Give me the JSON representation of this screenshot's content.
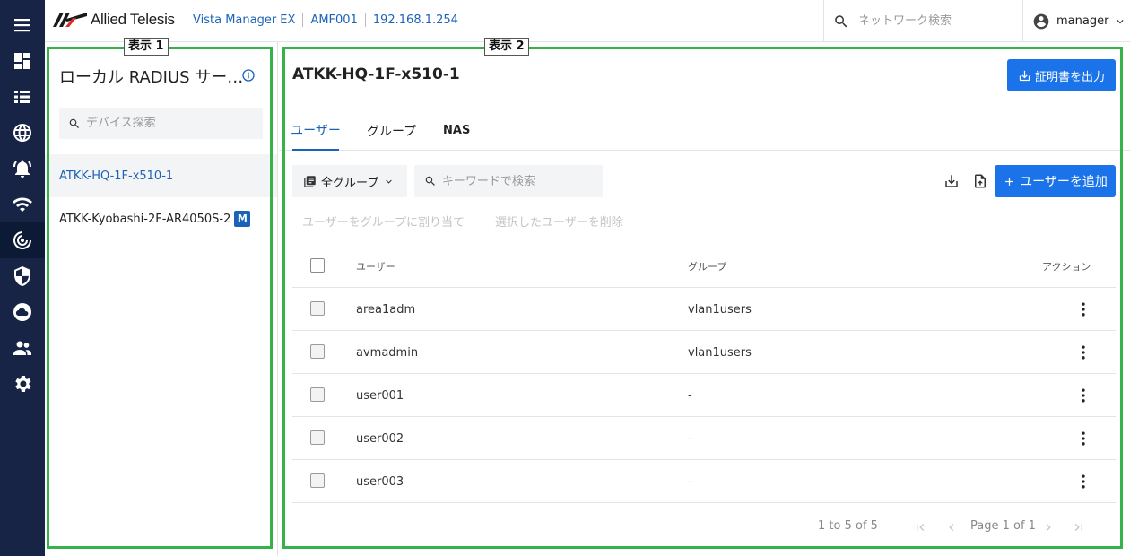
{
  "app": {
    "logo_text": "Allied Telesis",
    "breadcrumbs": [
      "Vista Manager EX",
      "AMF001",
      "192.168.1.254"
    ],
    "search_placeholder": "ネットワーク検索",
    "user_name": "manager"
  },
  "nav": {
    "items": [
      "menu-icon",
      "dashboard-icon",
      "list-icon",
      "globe-icon",
      "alarm-bell-icon",
      "wifi-icon",
      "radius-icon",
      "shield-icon",
      "cloud-icon",
      "people-icon",
      "gear-icon"
    ],
    "active_item": "radius-icon"
  },
  "annotations": {
    "left_label": "表示 1",
    "right_label": "表示 2",
    "frame_color": "#35b24a"
  },
  "left_panel": {
    "title": "ローカル RADIUS サー…",
    "search_placeholder": "デバイス探索",
    "devices": [
      {
        "name": "ATKK-HQ-1F-x510-1",
        "selected": true,
        "badge": ""
      },
      {
        "name": "ATKK-Kyobashi-2F-AR4050S-2",
        "selected": false,
        "badge": "M"
      }
    ]
  },
  "right_panel": {
    "title": "ATKK-HQ-1F-x510-1",
    "export_cert_label": "証明書を出力",
    "tabs": [
      {
        "label": "ユーザー",
        "active": true
      },
      {
        "label": "グループ",
        "active": false
      },
      {
        "label": "NAS",
        "active": false
      }
    ],
    "group_filter_label": "全グループ",
    "search_placeholder": "キーワードで検索",
    "add_user_label": "ユーザーを追加",
    "assign_group_label": "ユーザーをグループに割り当て",
    "delete_selected_label": "選択したユーザーを削除",
    "columns": {
      "user": "ユーザー",
      "group": "グループ",
      "action": "アクション"
    },
    "rows": [
      {
        "user": "area1adm",
        "group": "vlan1users"
      },
      {
        "user": "avmadmin",
        "group": "vlan1users"
      },
      {
        "user": "user001",
        "group": "-"
      },
      {
        "user": "user002",
        "group": "-"
      },
      {
        "user": "user003",
        "group": "-"
      }
    ],
    "pagination": {
      "range": "1 to 5 of 5",
      "page": "Page 1 of 1"
    }
  },
  "colors": {
    "accent": "#1a73e8",
    "link": "#1b63b8",
    "nav_bg": "#172446"
  }
}
